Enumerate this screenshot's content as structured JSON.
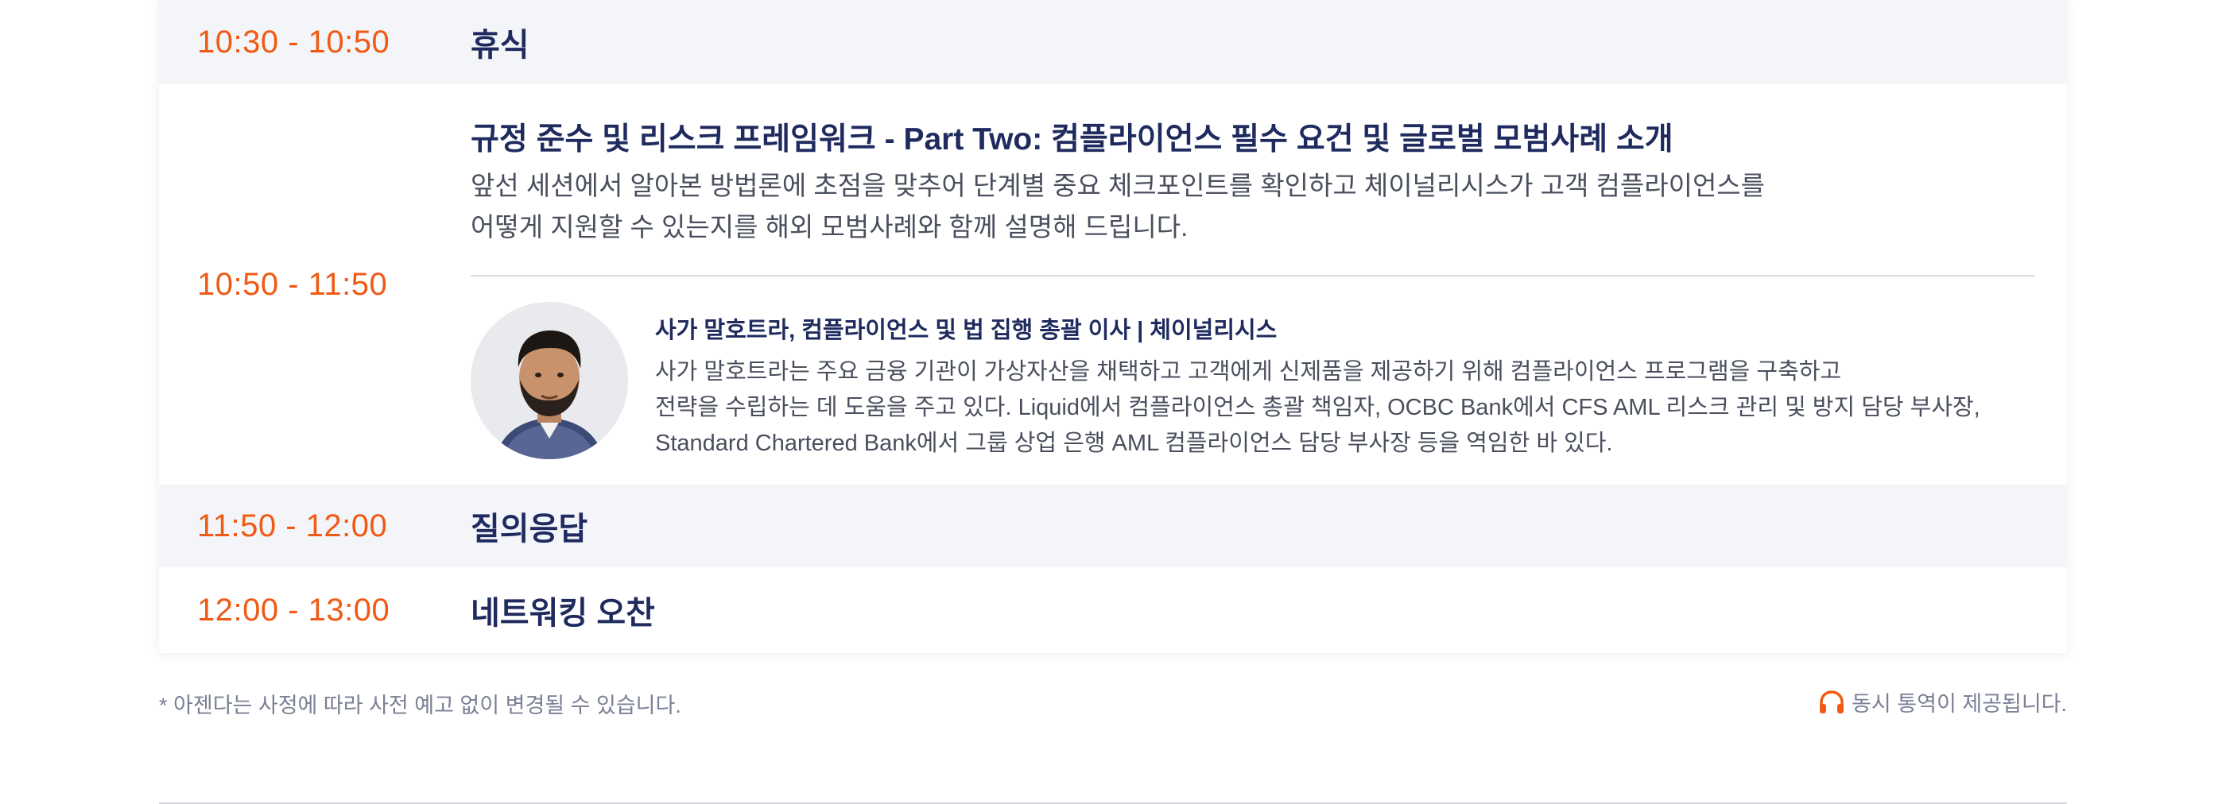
{
  "agenda": [
    {
      "time": "10:30 - 10:50",
      "title": "휴식"
    },
    {
      "time": "10:50 - 11:50",
      "title": "규정 준수 및 리스크 프레임워크 - Part Two: 컴플라이언스 필수 요건 및 글로벌 모범사례 소개",
      "description": [
        "앞선 세션에서 알아본 방법론에 초점을 맞추어 단계별 중요 체크포인트를 확인하고 체이널리시스가 고객 컴플라이언스를",
        "어떻게 지원할 수 있는지를 해외 모범사례와 함께 설명해 드립니다."
      ],
      "speaker": {
        "name": "사가 말호트라, 컴플라이언스 및 법 집행 총괄 이사 | 체이널리시스",
        "bio": [
          "사가 말호트라는 주요 금융 기관이 가상자산을 채택하고 고객에게 신제품을 제공하기 위해 컴플라이언스 프로그램을 구축하고",
          "전략을 수립하는 데 도움을 주고 있다. Liquid에서 컴플라이언스 총괄 책임자, OCBC Bank에서 CFS AML 리스크 관리 및 방지 담당 부사장,",
          "Standard Chartered Bank에서 그룹 상업 은행 AML 컴플라이언스 담당 부사장 등을 역임한 바 있다."
        ]
      }
    },
    {
      "time": "11:50 - 12:00",
      "title": "질의응답"
    },
    {
      "time": "12:00 - 13:00",
      "title": "네트워킹 오찬"
    }
  ],
  "footer": {
    "note": "* 아젠다는 사정에 따라 사전 예고 없이 변경될 수 있습니다.",
    "interpretation": "동시 통역이 제공됩니다."
  },
  "colors": {
    "time_accent": "#f05a14",
    "title_navy": "#1f2b5e",
    "row_gray": "#f3f5f9"
  },
  "icons": {
    "interpretation": "headphones-icon"
  }
}
